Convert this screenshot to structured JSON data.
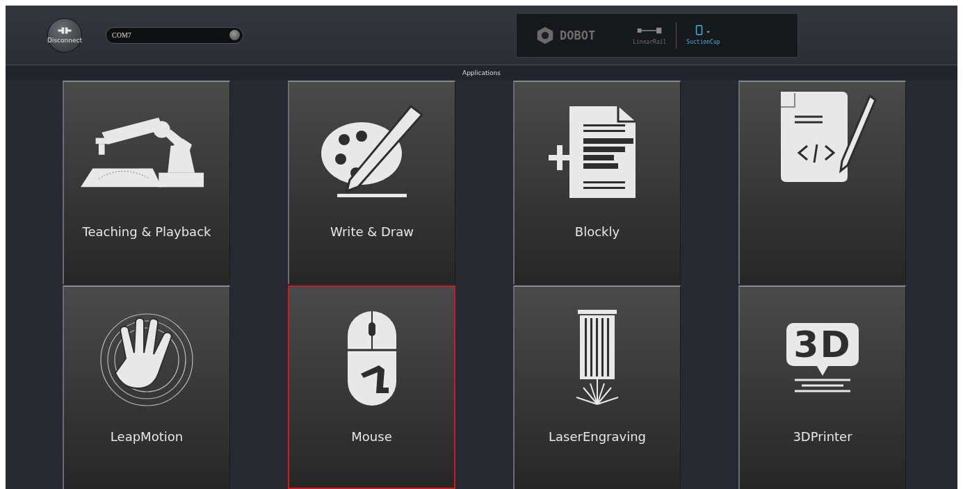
{
  "toolbar": {
    "connect_button": "Disconnect",
    "port": "COM7"
  },
  "device_panel": {
    "brand": "DOBOT",
    "tools": [
      {
        "kind": "rail",
        "label": "LinearRail",
        "selected": false
      },
      {
        "kind": "cup",
        "label": "SuctionCup",
        "selected": true
      }
    ]
  },
  "section_title": "Applications",
  "apps": [
    {
      "kind": "teaching",
      "label": "Teaching & Playback",
      "selected": false
    },
    {
      "kind": "draw",
      "label": "Write & Draw",
      "selected": false
    },
    {
      "kind": "blockly",
      "label": "Blockly",
      "selected": false
    },
    {
      "kind": "script",
      "selected": false
    },
    {
      "kind": "leap",
      "label": "LeapMotion",
      "selected": false
    },
    {
      "kind": "mouse",
      "label": "Mouse",
      "selected": true
    },
    {
      "kind": "laser",
      "label": "LaserEngraving",
      "selected": false
    },
    {
      "kind": "printer",
      "icon_text": "3D",
      "label": "3DPrinter",
      "selected": false
    }
  ]
}
